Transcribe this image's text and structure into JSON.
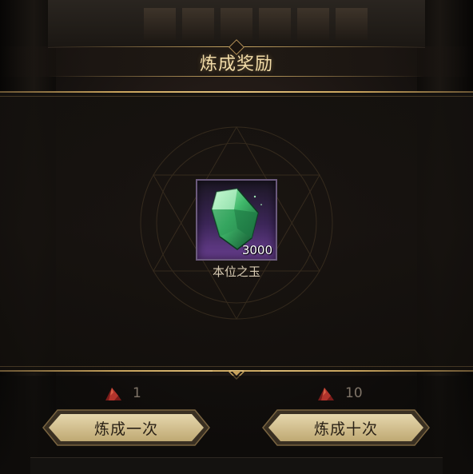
{
  "title": "炼成奖励",
  "reward": {
    "item_name": "本位之玉",
    "count": "3000",
    "icon": "green-jade-gem-icon",
    "rarity_color": "#6a3f92"
  },
  "costs": {
    "once": "1",
    "ten": "10",
    "icon": "red-crystal-icon"
  },
  "buttons": {
    "once_label": "炼成一次",
    "ten_label": "炼成十次"
  },
  "colors": {
    "gold_accent": "#c9a864",
    "title_text": "#f2dca8",
    "button_fill": "#d8c79a"
  }
}
